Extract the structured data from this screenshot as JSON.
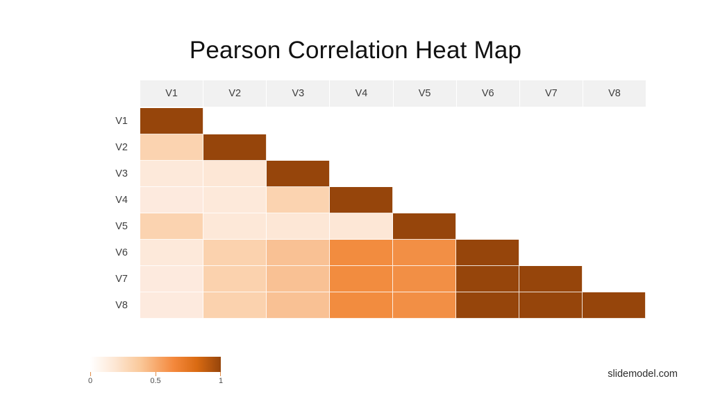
{
  "title": "Pearson Correlation Heat Map",
  "watermark": "slidemodel.com",
  "legend": {
    "ticks": [
      {
        "label": "0",
        "pos": 0
      },
      {
        "label": "0.5",
        "pos": 0.5
      },
      {
        "label": "1",
        "pos": 1
      }
    ],
    "gradient_low": "#ffffff",
    "gradient_mid": "#f4883c",
    "gradient_high": "#96450b"
  },
  "chart_data": {
    "type": "heatmap",
    "title": "Pearson Correlation Heat Map",
    "xlabel": "",
    "ylabel": "",
    "legend_position": "bottom-left",
    "grid": true,
    "triangle": "lower",
    "color_scale": {
      "min": 0,
      "max": 1,
      "ticks": [
        0,
        0.5,
        1
      ],
      "low_color": "#ffffff",
      "mid_color": "#f4883c",
      "high_color": "#96450b"
    },
    "x_categories": [
      "V1",
      "V2",
      "V3",
      "V4",
      "V5",
      "V6",
      "V7",
      "V8"
    ],
    "y_categories": [
      "V1",
      "V2",
      "V3",
      "V4",
      "V5",
      "V6",
      "V7",
      "V8"
    ],
    "rows": [
      {
        "label": "V1",
        "cells": [
          {
            "col": "V1",
            "value": 1.0,
            "color": "#96450b"
          },
          {
            "col": "V2",
            "value": null,
            "color": null
          },
          {
            "col": "V3",
            "value": null,
            "color": null
          },
          {
            "col": "V4",
            "value": null,
            "color": null
          },
          {
            "col": "V5",
            "value": null,
            "color": null
          },
          {
            "col": "V6",
            "value": null,
            "color": null
          },
          {
            "col": "V7",
            "value": null,
            "color": null
          },
          {
            "col": "V8",
            "value": null,
            "color": null
          }
        ]
      },
      {
        "label": "V2",
        "cells": [
          {
            "col": "V1",
            "value": 0.26,
            "color": "#fbd3b0"
          },
          {
            "col": "V2",
            "value": 1.0,
            "color": "#96450b"
          },
          {
            "col": "V3",
            "value": null,
            "color": null
          },
          {
            "col": "V4",
            "value": null,
            "color": null
          },
          {
            "col": "V5",
            "value": null,
            "color": null
          },
          {
            "col": "V6",
            "value": null,
            "color": null
          },
          {
            "col": "V7",
            "value": null,
            "color": null
          },
          {
            "col": "V8",
            "value": null,
            "color": null
          }
        ]
      },
      {
        "label": "V3",
        "cells": [
          {
            "col": "V1",
            "value": 0.1,
            "color": "#fde9da"
          },
          {
            "col": "V2",
            "value": 0.11,
            "color": "#fde7d6"
          },
          {
            "col": "V3",
            "value": 1.0,
            "color": "#96450b"
          },
          {
            "col": "V4",
            "value": null,
            "color": null
          },
          {
            "col": "V5",
            "value": null,
            "color": null
          },
          {
            "col": "V6",
            "value": null,
            "color": null
          },
          {
            "col": "V7",
            "value": null,
            "color": null
          },
          {
            "col": "V8",
            "value": null,
            "color": null
          }
        ]
      },
      {
        "label": "V4",
        "cells": [
          {
            "col": "V1",
            "value": 0.09,
            "color": "#fdeade"
          },
          {
            "col": "V2",
            "value": 0.1,
            "color": "#fde9da"
          },
          {
            "col": "V3",
            "value": 0.25,
            "color": "#fbd3b0"
          },
          {
            "col": "V4",
            "value": 1.0,
            "color": "#96450b"
          },
          {
            "col": "V5",
            "value": null,
            "color": null
          },
          {
            "col": "V6",
            "value": null,
            "color": null
          },
          {
            "col": "V7",
            "value": null,
            "color": null
          },
          {
            "col": "V8",
            "value": null,
            "color": null
          }
        ]
      },
      {
        "label": "V5",
        "cells": [
          {
            "col": "V1",
            "value": 0.25,
            "color": "#fbd3b0"
          },
          {
            "col": "V2",
            "value": 0.11,
            "color": "#fde8d8"
          },
          {
            "col": "V3",
            "value": 0.12,
            "color": "#fde7d6"
          },
          {
            "col": "V4",
            "value": 0.12,
            "color": "#fde7d6"
          },
          {
            "col": "V5",
            "value": 1.0,
            "color": "#96450b"
          },
          {
            "col": "V6",
            "value": null,
            "color": null
          },
          {
            "col": "V7",
            "value": null,
            "color": null
          },
          {
            "col": "V8",
            "value": null,
            "color": null
          }
        ]
      },
      {
        "label": "V6",
        "cells": [
          {
            "col": "V1",
            "value": 0.1,
            "color": "#fde9da"
          },
          {
            "col": "V2",
            "value": 0.25,
            "color": "#fbd2ae"
          },
          {
            "col": "V3",
            "value": 0.32,
            "color": "#f9c194"
          },
          {
            "col": "V4",
            "value": 0.62,
            "color": "#f28c3f"
          },
          {
            "col": "V5",
            "value": 0.61,
            "color": "#f28f45"
          },
          {
            "col": "V6",
            "value": 1.0,
            "color": "#96450b"
          },
          {
            "col": "V7",
            "value": null,
            "color": null
          },
          {
            "col": "V8",
            "value": null,
            "color": null
          }
        ]
      },
      {
        "label": "V7",
        "cells": [
          {
            "col": "V1",
            "value": 0.09,
            "color": "#fdeade"
          },
          {
            "col": "V2",
            "value": 0.25,
            "color": "#fbd2ae"
          },
          {
            "col": "V3",
            "value": 0.33,
            "color": "#f9c194"
          },
          {
            "col": "V4",
            "value": 0.63,
            "color": "#f28c3f"
          },
          {
            "col": "V5",
            "value": 0.62,
            "color": "#f28f45"
          },
          {
            "col": "V6",
            "value": 1.0,
            "color": "#96450b"
          },
          {
            "col": "V7",
            "value": 1.0,
            "color": "#96450b"
          },
          {
            "col": "V8",
            "value": null,
            "color": null
          }
        ]
      },
      {
        "label": "V8",
        "cells": [
          {
            "col": "V1",
            "value": 0.09,
            "color": "#fdeade"
          },
          {
            "col": "V2",
            "value": 0.25,
            "color": "#fbd2ae"
          },
          {
            "col": "V3",
            "value": 0.33,
            "color": "#f9c194"
          },
          {
            "col": "V4",
            "value": 0.63,
            "color": "#f28c3f"
          },
          {
            "col": "V5",
            "value": 0.62,
            "color": "#f28f45"
          },
          {
            "col": "V6",
            "value": 1.0,
            "color": "#96450b"
          },
          {
            "col": "V7",
            "value": 1.0,
            "color": "#96450b"
          },
          {
            "col": "V8",
            "value": 1.0,
            "color": "#96450b"
          }
        ]
      }
    ]
  }
}
